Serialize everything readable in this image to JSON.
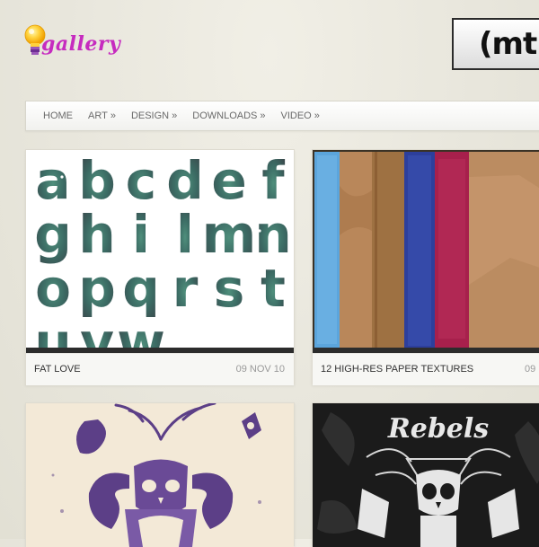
{
  "site": {
    "logo_text": "gallery"
  },
  "ad": {
    "text": "(mt"
  },
  "nav": {
    "items": [
      {
        "label": "HOME",
        "arrow": ""
      },
      {
        "label": "ART",
        "arrow": "»"
      },
      {
        "label": "DESIGN",
        "arrow": "»"
      },
      {
        "label": "DOWNLOADS",
        "arrow": "»"
      },
      {
        "label": "VIDEO",
        "arrow": "»"
      }
    ]
  },
  "posts": [
    {
      "title": "FAT LOVE",
      "date": "09 NOV 10"
    },
    {
      "title": "12 HIGH-RES PAPER TEXTURES",
      "date": "09"
    },
    {
      "title": "",
      "date": ""
    },
    {
      "title": "",
      "date": ""
    }
  ],
  "art": {
    "alphabet_letters": [
      "a",
      "b",
      "c",
      "d",
      "e",
      "f",
      "g",
      "h",
      "i",
      "l",
      "m",
      "n",
      "o",
      "p",
      "q",
      "r",
      "s",
      "t",
      "u",
      "v",
      "w"
    ],
    "rebels_title": "Rebels"
  },
  "colors": {
    "logo": "#c62bbf",
    "nav_text": "#6a6a6a",
    "paper_strips": [
      "#5ba5dc",
      "#b9875a",
      "#9e7142",
      "#8a5e3b",
      "#2d3f9c",
      "#a7204c",
      "#bb8c61"
    ]
  }
}
